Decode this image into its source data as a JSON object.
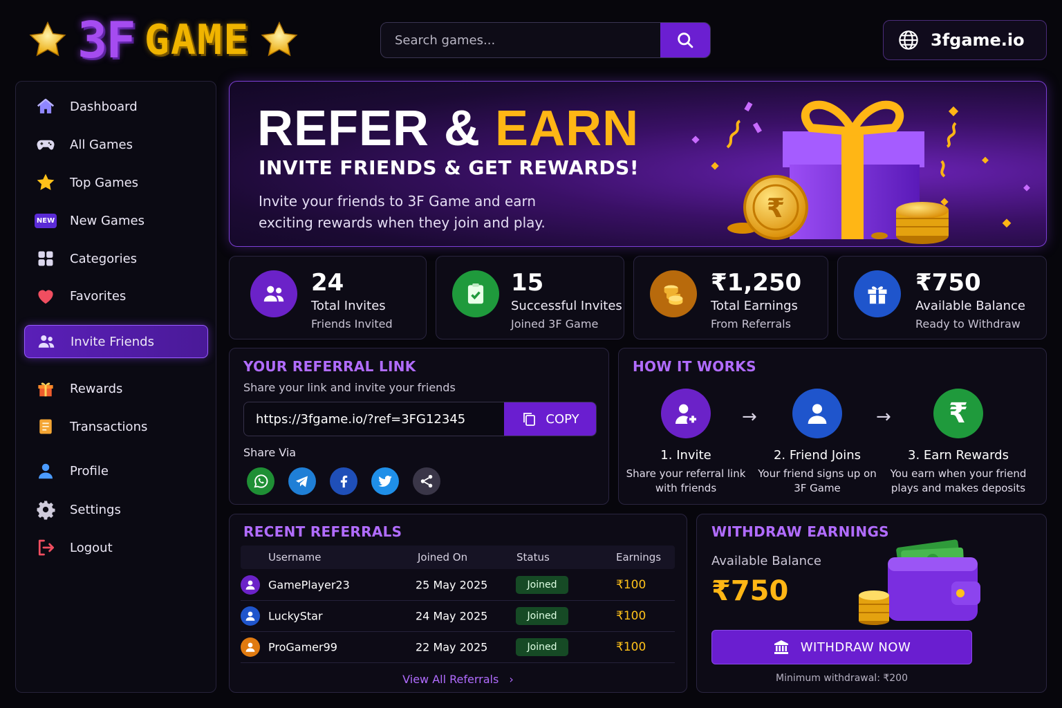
{
  "brand": {
    "logo_part1": "3F",
    "logo_part2": "GAME"
  },
  "search": {
    "placeholder": "Search games..."
  },
  "site": {
    "domain": "3fgame.io"
  },
  "sidebar": {
    "items": [
      {
        "label": "Dashboard",
        "icon": "home-icon"
      },
      {
        "label": "All Games",
        "icon": "gamepad-icon"
      },
      {
        "label": "Top Games",
        "icon": "star-icon"
      },
      {
        "label": "New Games",
        "icon": "new-badge-icon",
        "badge": "NEW"
      },
      {
        "label": "Categories",
        "icon": "grid-icon"
      },
      {
        "label": "Favorites",
        "icon": "heart-icon"
      },
      {
        "label": "Invite Friends",
        "icon": "users-icon",
        "active": true
      },
      {
        "label": "Rewards",
        "icon": "gift-icon"
      },
      {
        "label": "Transactions",
        "icon": "document-icon"
      },
      {
        "label": "Profile",
        "icon": "user-icon"
      },
      {
        "label": "Settings",
        "icon": "gear-icon"
      },
      {
        "label": "Logout",
        "icon": "logout-icon"
      }
    ]
  },
  "banner": {
    "title_part1": "REFER &",
    "title_part2": "EARN",
    "subtitle": "INVITE FRIENDS & GET REWARDS!",
    "description": "Invite your friends to 3F Game and earn exciting rewards when they join and play."
  },
  "stats": [
    {
      "value": "24",
      "label": "Total Invites",
      "sub": "Friends Invited",
      "icon": "users-icon",
      "color": "#6b22c8"
    },
    {
      "value": "15",
      "label": "Successful Invites",
      "sub": "Joined 3F Game",
      "icon": "check-clipboard-icon",
      "color": "#1f9a3c"
    },
    {
      "value": "₹1,250",
      "label": "Total Earnings",
      "sub": "From Referrals",
      "icon": "coins-icon",
      "color": "#b86a0c"
    },
    {
      "value": "₹750",
      "label": "Available Balance",
      "sub": "Ready to Withdraw",
      "icon": "gift-icon",
      "color": "#1f55cc"
    }
  ],
  "referral": {
    "title": "YOUR REFERRAL LINK",
    "subtitle": "Share your link and invite your friends",
    "url": "https://3fgame.io/?ref=3FG12345",
    "copy_label": "COPY",
    "share_label": "Share Via",
    "share_icons": [
      "whatsapp-icon",
      "telegram-icon",
      "facebook-icon",
      "twitter-icon",
      "share-icon"
    ]
  },
  "how_it_works": {
    "title": "HOW IT WORKS",
    "steps": [
      {
        "title": "1. Invite",
        "desc": "Share your referral link with friends",
        "icon": "user-plus-icon",
        "color": "#6b22c8"
      },
      {
        "title": "2. Friend Joins",
        "desc": "Your friend signs up on 3F Game",
        "icon": "user-icon",
        "color": "#1f55cc"
      },
      {
        "title": "3. Earn Rewards",
        "desc": "You earn when your friend plays and makes deposits",
        "icon": "rupee-icon",
        "color": "#1f9a3c"
      }
    ]
  },
  "recent": {
    "title": "RECENT REFERRALS",
    "columns": [
      "Username",
      "Joined On",
      "Status",
      "Earnings"
    ],
    "rows": [
      {
        "username": "GamePlayer23",
        "joined": "25 May 2025",
        "status": "Joined",
        "earnings": "₹100",
        "avatar_color": "#6b22c8"
      },
      {
        "username": "LuckyStar",
        "joined": "24 May 2025",
        "status": "Joined",
        "earnings": "₹100",
        "avatar_color": "#1f55cc"
      },
      {
        "username": "ProGamer99",
        "joined": "22 May 2025",
        "status": "Joined",
        "earnings": "₹100",
        "avatar_color": "#e07a10"
      }
    ],
    "view_all": "View All Referrals"
  },
  "withdraw": {
    "title": "WITHDRAW EARNINGS",
    "balance_label": "Available Balance",
    "balance": "₹750",
    "button": "WITHDRAW NOW",
    "minimum": "Minimum withdrawal: ₹200"
  }
}
